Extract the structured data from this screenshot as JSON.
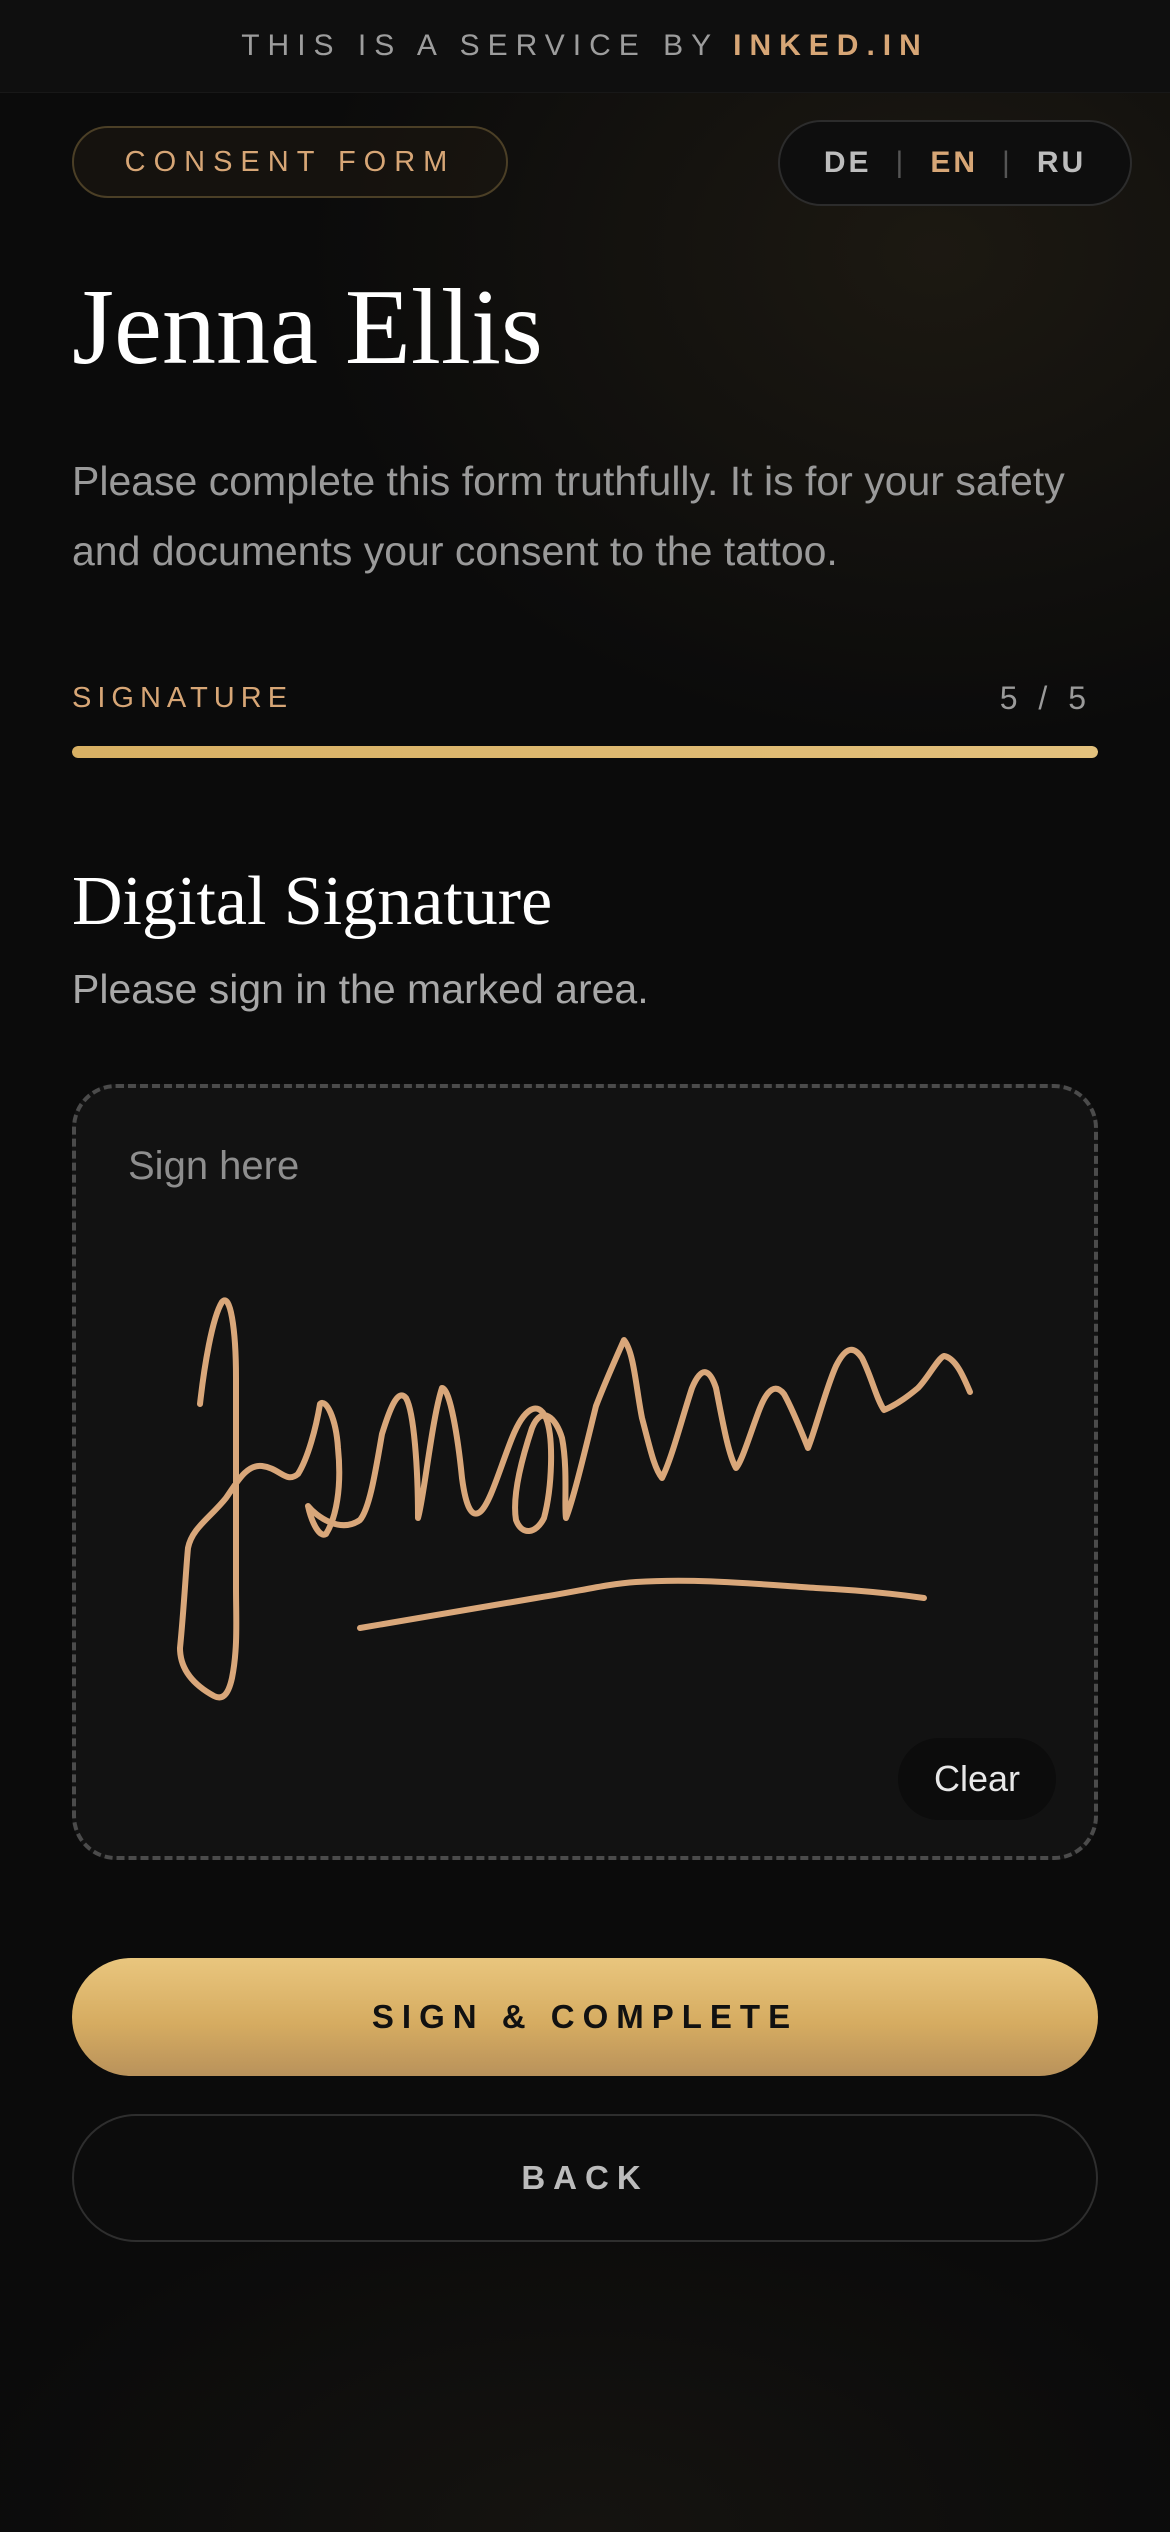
{
  "topbar": {
    "prefix": "THIS IS A SERVICE BY",
    "brand": "INKED.IN"
  },
  "header": {
    "form_badge": "CONSENT FORM",
    "languages": [
      {
        "label": "DE",
        "active": false
      },
      {
        "label": "EN",
        "active": true
      },
      {
        "label": "RU",
        "active": false
      }
    ]
  },
  "client_name": "Jenna Ellis",
  "intro_text": "Please complete this form truthfully. It is for your safety and documents your consent to the tattoo.",
  "progress": {
    "step_label": "SIGNATURE",
    "step_count": "5 / 5",
    "fraction": 1.0
  },
  "signature_section": {
    "title": "Digital Signature",
    "subtitle": "Please sign in the marked area.",
    "placeholder": "Sign here",
    "clear_label": "Clear",
    "stroke_color": "#d9a77a"
  },
  "actions": {
    "primary_label": "SIGN & COMPLETE",
    "secondary_label": "BACK"
  },
  "colors": {
    "accent": "#d7a676",
    "gold_button": "#d6ac61",
    "background": "#0b0b0b"
  }
}
